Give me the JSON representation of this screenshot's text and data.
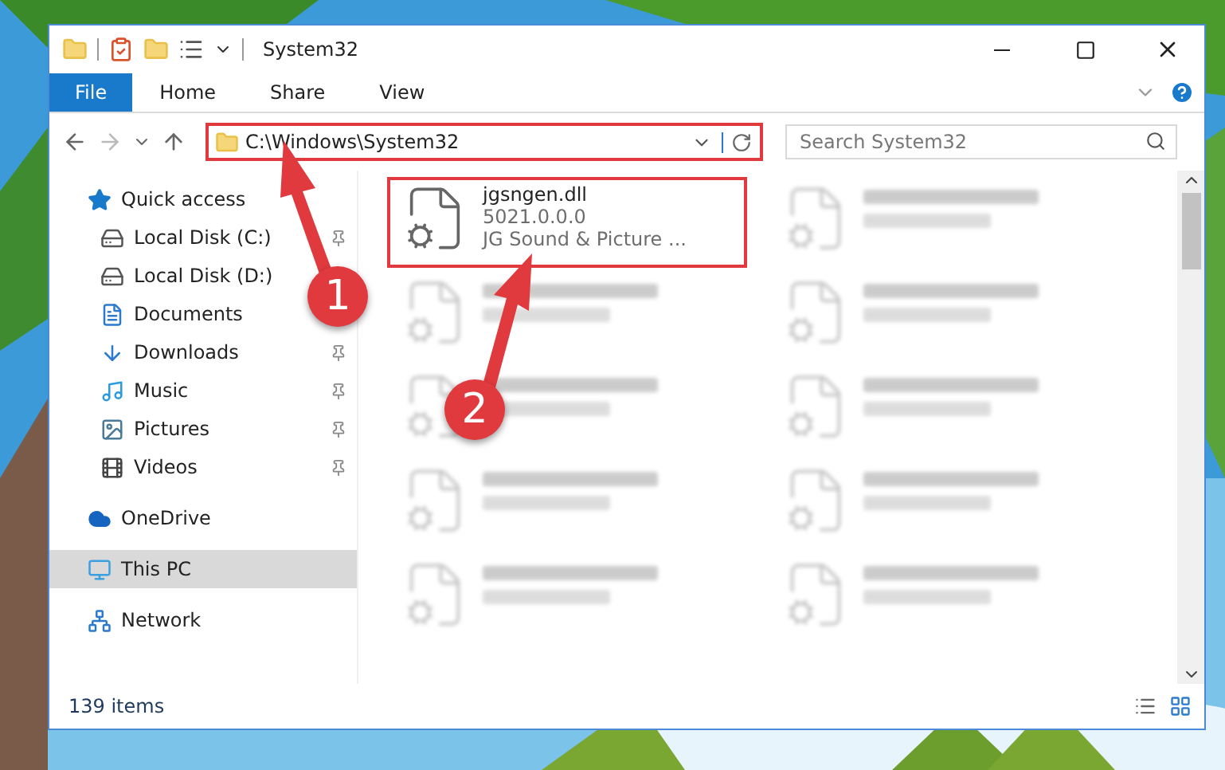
{
  "window": {
    "title": "System32"
  },
  "ribbon_tabs": [
    {
      "label": "File",
      "kind": "file"
    },
    {
      "label": "Home",
      "kind": "tab"
    },
    {
      "label": "Share",
      "kind": "tab"
    },
    {
      "label": "View",
      "kind": "tab"
    }
  ],
  "address": {
    "path": "C:\\Windows\\System32",
    "highlighted": true
  },
  "search": {
    "placeholder": "Search System32"
  },
  "nav": [
    {
      "label": "Quick access",
      "selected": false,
      "children": [
        {
          "label": "Local Disk (C:)",
          "pinned": true,
          "selected": false
        },
        {
          "label": "Local Disk (D:)",
          "pinned": false,
          "selected": false
        },
        {
          "label": "Documents",
          "pinned": false,
          "selected": false
        },
        {
          "label": "Downloads",
          "pinned": true,
          "selected": false
        },
        {
          "label": "Music",
          "pinned": true,
          "selected": false
        },
        {
          "label": "Pictures",
          "pinned": true,
          "selected": false
        },
        {
          "label": "Videos",
          "pinned": true,
          "selected": false
        }
      ]
    },
    {
      "label": "OneDrive",
      "selected": false
    },
    {
      "label": "This PC",
      "selected": true
    },
    {
      "label": "Network",
      "selected": false
    }
  ],
  "files": [
    {
      "kind": "file",
      "name": "jgsngen.dll",
      "details": [
        "5021.0.0.0",
        "JG Sound & Picture ..."
      ],
      "highlighted": true
    },
    {
      "kind": "blurred"
    },
    {
      "kind": "blurred"
    },
    {
      "kind": "blurred"
    },
    {
      "kind": "blurred"
    },
    {
      "kind": "blurred"
    },
    {
      "kind": "blurred"
    },
    {
      "kind": "blurred"
    },
    {
      "kind": "blurred"
    },
    {
      "kind": "blurred"
    }
  ],
  "status_bar": {
    "count": "139 items"
  },
  "annotations": [
    {
      "number": "1"
    },
    {
      "number": "2"
    }
  ]
}
